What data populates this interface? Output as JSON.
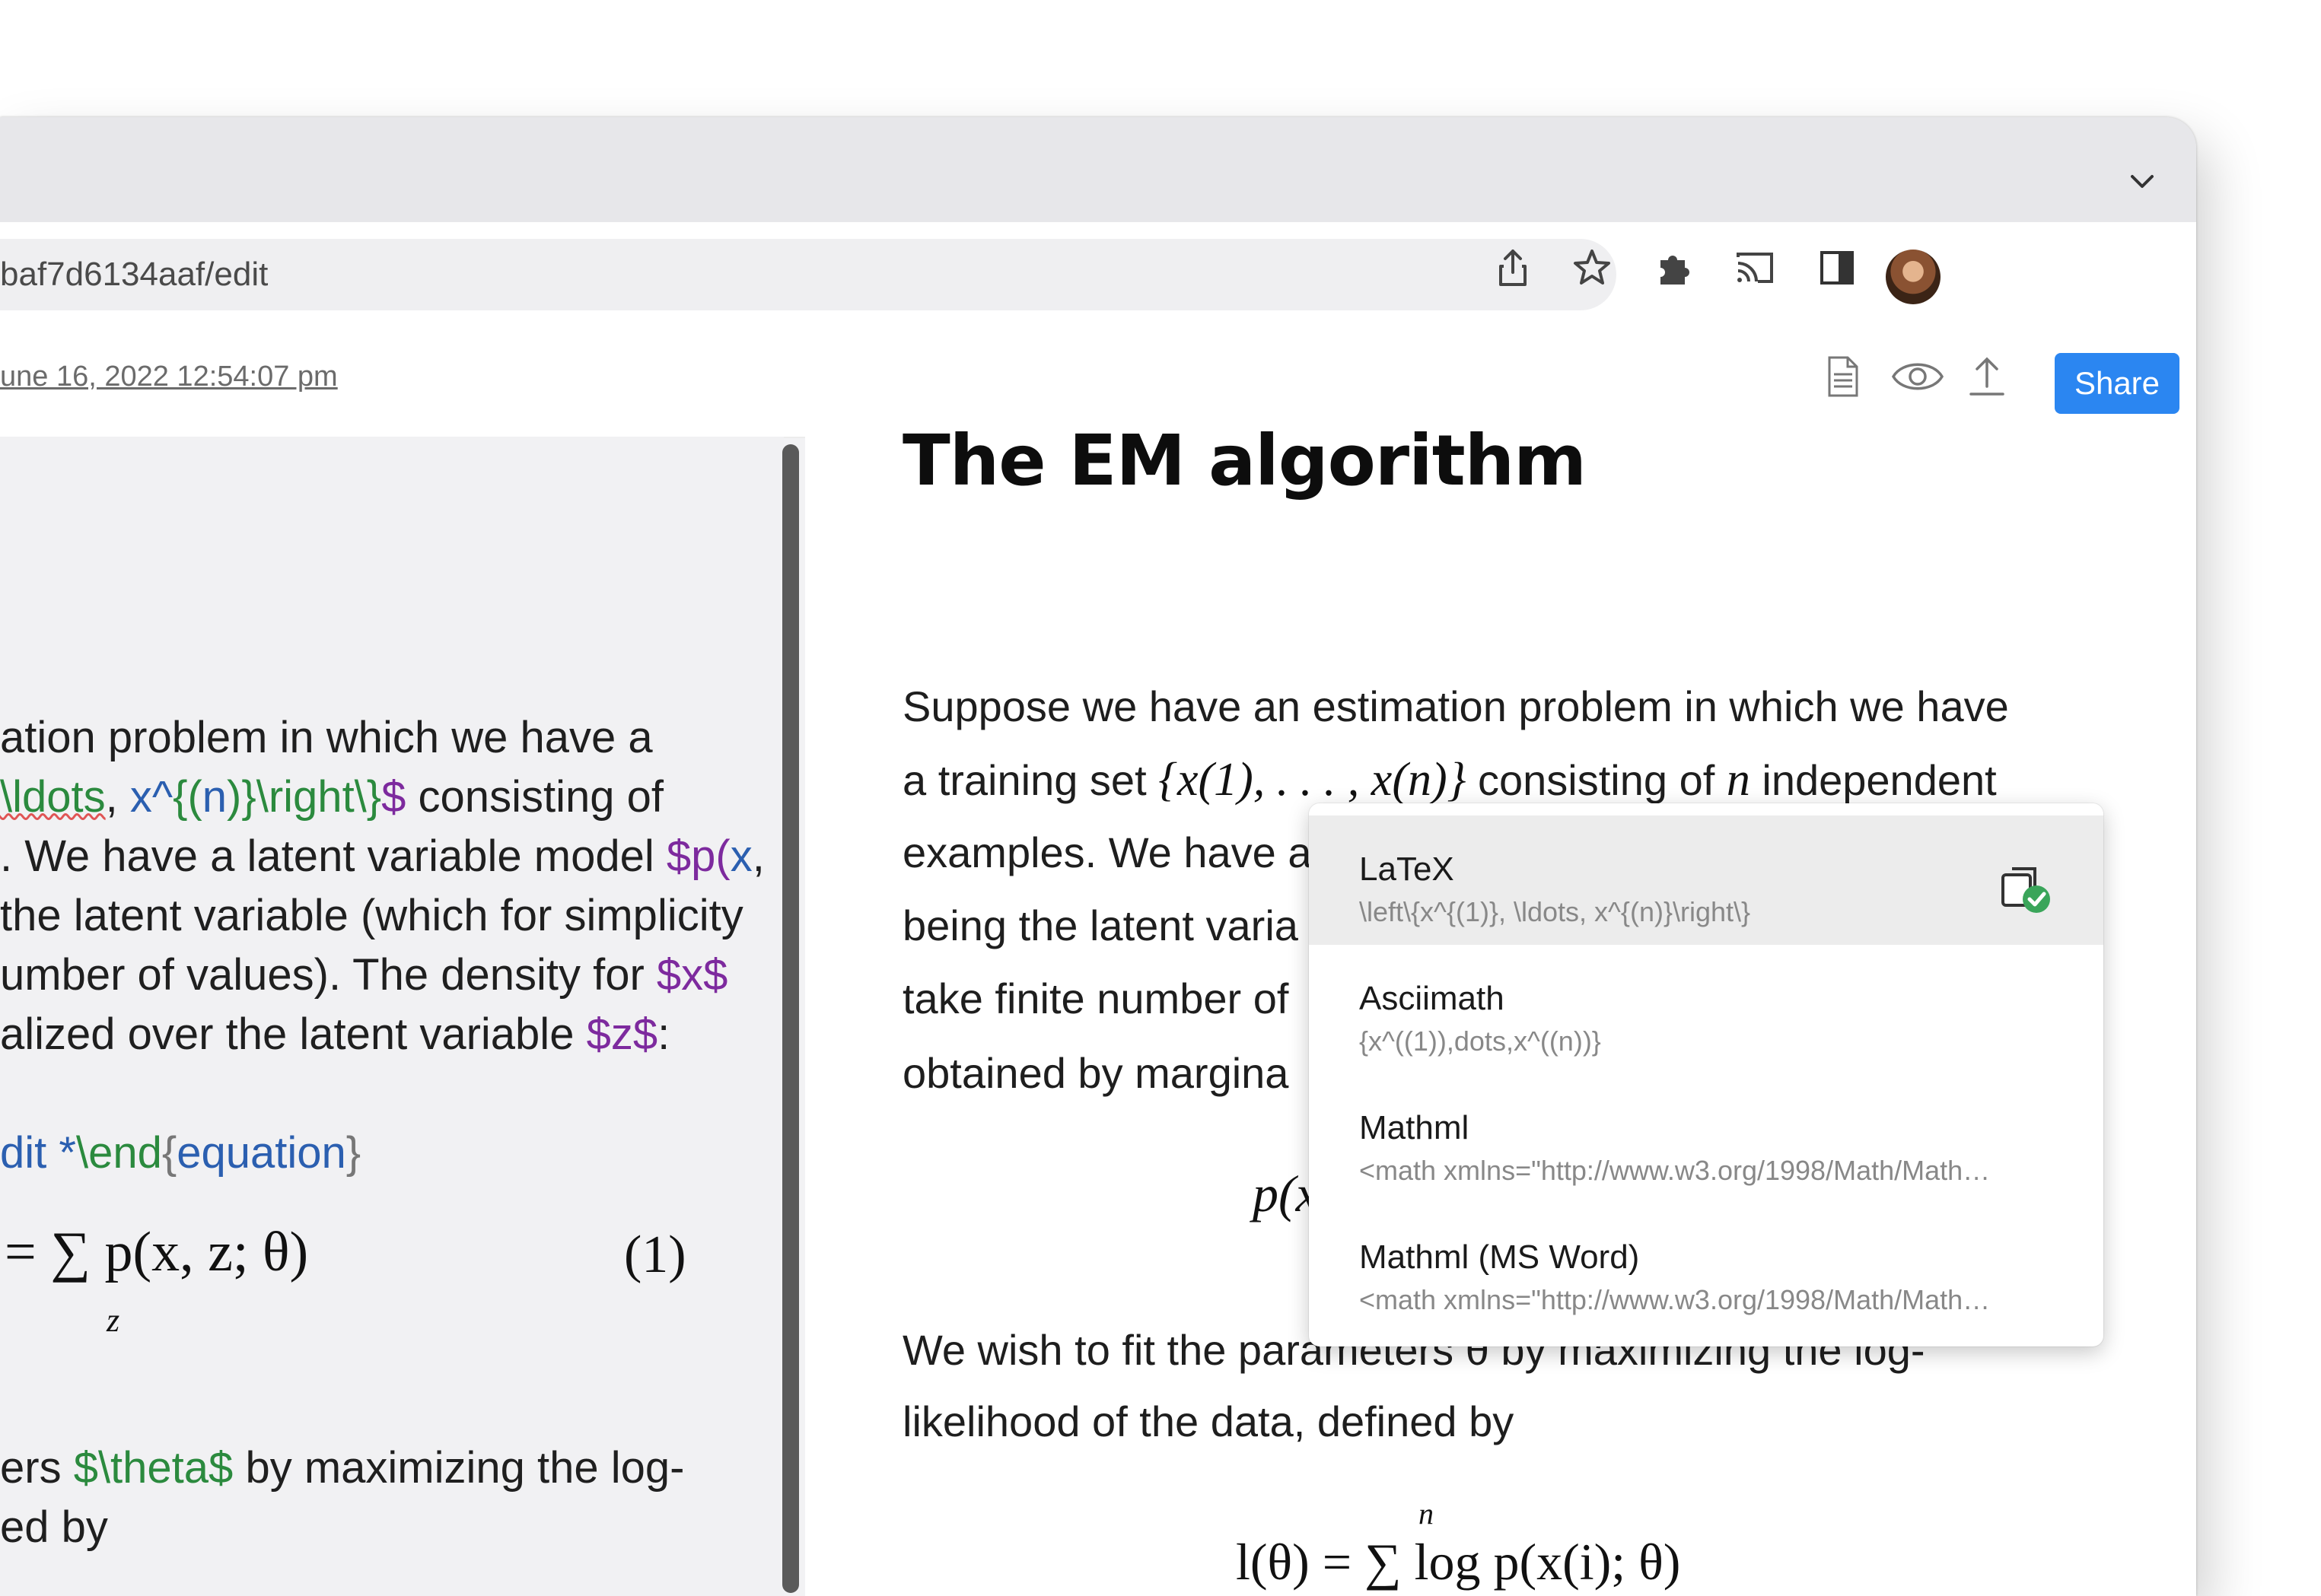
{
  "browser": {
    "url": "baf7d6134aaf/edit"
  },
  "app_header": {
    "saved_time": "une 16, 2022 12:54:07 pm",
    "share_label": "Share"
  },
  "editor": {
    "lines": [
      {
        "parts": [
          "ation problem in which we have a"
        ]
      },
      {
        "parts": [
          "\\ldots",
          ", ",
          "x^",
          "{(",
          "n",
          ")}",
          "\\right\\}",
          "$",
          " consisting of"
        ]
      },
      {
        "parts": [
          ". We have a latent variable model ",
          "$p(",
          "x",
          ","
        ]
      },
      {
        "parts": [
          "the latent variable (which for simplicity"
        ]
      },
      {
        "parts": [
          "umber of values). The density for ",
          "$x$"
        ]
      },
      {
        "parts": [
          "alized over the latent variable ",
          "$z$",
          ":"
        ]
      },
      {
        "parts": [
          "dit *",
          "\\end",
          "{",
          "equation",
          "}"
        ]
      },
      {
        "parts": [
          "ers ",
          "$\\theta$",
          " by maximizing the log-"
        ]
      },
      {
        "parts": [
          "ed by"
        ]
      }
    ],
    "math_line": "= ∑ p(x, z; θ)",
    "math_sub": "z",
    "equation_number": "(1)"
  },
  "preview": {
    "title": "The EM algorithm",
    "para1": [
      "Suppose we have an estimation problem in which we have",
      "a training set",
      "consisting of",
      "independent",
      "examples. We have a",
      "being the latent varia",
      "take finite number of",
      "obtained by margina"
    ],
    "set_math": "{x(1), . . . , x(n)}",
    "n_var": "n",
    "para2": [
      "We wish to fit the parameters θ by maximizing the log-",
      "likelihood of the data, defined by"
    ],
    "eq_partial": "p(x",
    "eq2": "l(θ) = ∑ log p(x(i); θ)",
    "eq2_top": "n"
  },
  "copy_popup": {
    "options": [
      {
        "title": "LaTeX",
        "value": "\\left\\{x^{(1)}, \\ldots, x^{(n)}\\right\\}",
        "active": true
      },
      {
        "title": "Asciimath",
        "value": "{x^((1)),dots,x^((n))}",
        "active": false
      },
      {
        "title": "Mathml",
        "value": "<math xmlns=\"http://www.w3.org/1998/Math/Math…",
        "active": false
      },
      {
        "title": "Mathml (MS Word)",
        "value": "<math xmlns=\"http://www.w3.org/1998/Math/Math…",
        "active": false
      }
    ]
  },
  "colors": {
    "accent": "#2b86f1",
    "latex_green": "#2b8a3e",
    "latex_purple": "#7d2a9e",
    "latex_blue": "#2b5fb0",
    "success_check": "#3aa55a"
  }
}
